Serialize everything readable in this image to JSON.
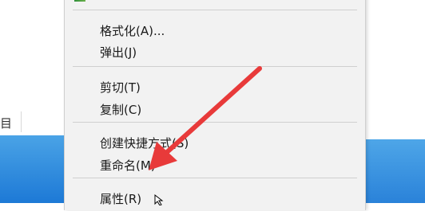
{
  "background": {
    "explorer_partial_text": "目"
  },
  "context_menu": {
    "items": [
      {
        "label": "格式化(A)..."
      },
      {
        "label": "弹出(J)"
      },
      {
        "label": "剪切(T)"
      },
      {
        "label": "复制(C)"
      },
      {
        "label": "创建快捷方式(S)"
      },
      {
        "label": "重命名(M)"
      },
      {
        "label": "属性(R)"
      }
    ]
  },
  "colors": {
    "menu_background": "#f2f2f2",
    "annotation_arrow": "#e83a3a",
    "desktop_blue": "#1d79d6"
  },
  "icons": {
    "top_item_icon": "drive-icon",
    "annotation": "red-arrow-icon",
    "pointer": "mouse-cursor-icon"
  }
}
